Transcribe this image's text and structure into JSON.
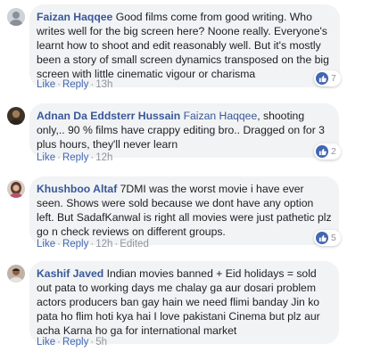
{
  "comments": [
    {
      "author": "Faizan Haqqee",
      "mention": "",
      "text": "Good films come from good writing. Who writes well for the big screen here? Noone really. Everyone's learnt how to shoot and edit reasonably well. But it's mostly been a story of small screen dynamics transposed on the big screen with little cinematic vigour or charisma",
      "like_label": "Like",
      "reply_label": "Reply",
      "time": "13h",
      "edited": "",
      "reaction_count": "7",
      "avatar_icon": "avatar-gray"
    },
    {
      "author": "Adnan Da Eddsterr Hussain",
      "mention": "Faizan Haqqee",
      "text": ", shooting only,.. 90 % films have crappy editing bro.. Dragged on for 3 plus hours, they'll never learn",
      "like_label": "Like",
      "reply_label": "Reply",
      "time": "12h",
      "edited": "",
      "reaction_count": "2",
      "avatar_icon": "avatar-dark"
    },
    {
      "author": "Khushboo Altaf",
      "mention": "",
      "text": "7DMI was the worst movie i have ever seen. Shows were sold because we dont have any option left. But SadafKanwal is right all movies were just pathetic plz go n check reviews on different groups.",
      "like_label": "Like",
      "reply_label": "Reply",
      "time": "12h",
      "edited": "Edited",
      "reaction_count": "5",
      "avatar_icon": "avatar-woman"
    },
    {
      "author": "Kashif Javed",
      "mention": "",
      "text": "Indian movies banned + Eid holidays = sold out pata to working days me chalay ga aur dosari problem actors producers ban gay hain we need flimi banday Jin ko pata ho flim hoti kya hai I love pakistani Cinema but plz aur acha Karna ho ga for international market",
      "like_label": "Like",
      "reply_label": "Reply",
      "time": "5h",
      "edited": "",
      "reaction_count": "",
      "avatar_icon": "avatar-man"
    }
  ],
  "colors": {
    "author": "#385898",
    "link": "#4267b2",
    "meta": "#90949c",
    "bubble": "#f2f3f5",
    "like_badge": "#4267b2"
  },
  "icons": {
    "reaction": "thumbs-up-icon",
    "separator": "middle-dot"
  }
}
